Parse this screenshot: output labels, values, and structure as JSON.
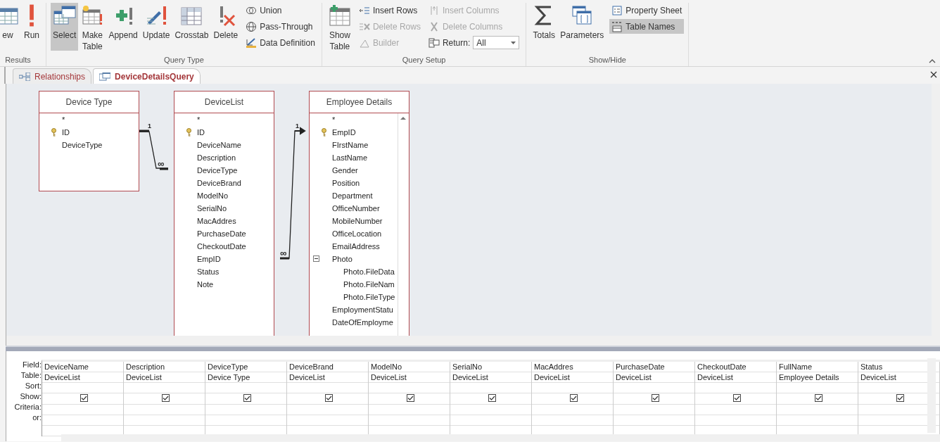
{
  "ribbon": {
    "groups": [
      {
        "label": "Results",
        "items": [
          {
            "kind": "large",
            "label": "ew",
            "selected": false
          },
          {
            "kind": "large",
            "label": "Run",
            "selected": false
          }
        ]
      },
      {
        "label": "Query Type",
        "items": [
          {
            "kind": "large",
            "label": "Select",
            "selected": true
          },
          {
            "kind": "large",
            "label": "Make Table",
            "selected": false
          },
          {
            "kind": "large",
            "label": "Append",
            "selected": false
          },
          {
            "kind": "large",
            "label": "Update",
            "selected": false
          },
          {
            "kind": "large",
            "label": "Crosstab",
            "selected": false
          },
          {
            "kind": "large",
            "label": "Delete",
            "selected": false
          },
          {
            "kind": "small",
            "label": "Union",
            "disabled": false,
            "on": false
          },
          {
            "kind": "small",
            "label": "Pass-Through",
            "disabled": false,
            "on": false
          },
          {
            "kind": "small",
            "label": "Data Definition",
            "disabled": false,
            "on": false
          }
        ]
      },
      {
        "label": "Query Setup",
        "items": [
          {
            "kind": "large",
            "label": "Show Table",
            "selected": false
          },
          {
            "kind": "small",
            "label": "Insert Rows",
            "disabled": false,
            "on": false
          },
          {
            "kind": "small",
            "label": "Delete Rows",
            "disabled": true,
            "on": false
          },
          {
            "kind": "small",
            "label": "Builder",
            "disabled": true,
            "on": false
          },
          {
            "kind": "small",
            "label": "Insert Columns",
            "disabled": true,
            "on": false
          },
          {
            "kind": "small",
            "label": "Delete Columns",
            "disabled": true,
            "on": false
          },
          {
            "kind": "dropdown",
            "label": "Return:",
            "value": "All"
          }
        ]
      },
      {
        "label": "Show/Hide",
        "items": [
          {
            "kind": "large",
            "label": "Totals",
            "selected": false
          },
          {
            "kind": "large",
            "label": "Parameters",
            "selected": false
          },
          {
            "kind": "small",
            "label": "Property Sheet",
            "disabled": false,
            "on": false
          },
          {
            "kind": "small",
            "label": "Table Names",
            "disabled": false,
            "on": true
          }
        ]
      }
    ]
  },
  "tabs": [
    {
      "label": "Relationships",
      "selected": false
    },
    {
      "label": "DeviceDetailsQuery",
      "selected": true
    }
  ],
  "design": {
    "tables": [
      {
        "name": "Device Type",
        "fields": [
          {
            "kind": "star",
            "label": "*"
          },
          {
            "kind": "key",
            "label": "ID"
          },
          {
            "kind": "field",
            "label": "DeviceType"
          }
        ]
      },
      {
        "name": "DeviceList",
        "fields": [
          {
            "kind": "star",
            "label": "*"
          },
          {
            "kind": "key",
            "label": "ID"
          },
          {
            "kind": "field",
            "label": "DeviceName"
          },
          {
            "kind": "field",
            "label": "Description"
          },
          {
            "kind": "field",
            "label": "DeviceType"
          },
          {
            "kind": "field",
            "label": "DeviceBrand"
          },
          {
            "kind": "field",
            "label": "ModelNo"
          },
          {
            "kind": "field",
            "label": "SerialNo"
          },
          {
            "kind": "field",
            "label": "MacAddres"
          },
          {
            "kind": "field",
            "label": "PurchaseDate"
          },
          {
            "kind": "field",
            "label": "CheckoutDate"
          },
          {
            "kind": "field",
            "label": "EmpID"
          },
          {
            "kind": "field",
            "label": "Status"
          },
          {
            "kind": "field",
            "label": "Note"
          }
        ]
      },
      {
        "name": "Employee Details",
        "fields": [
          {
            "kind": "star",
            "label": "*"
          },
          {
            "kind": "key",
            "label": "EmpID"
          },
          {
            "kind": "field",
            "label": "FIrstName"
          },
          {
            "kind": "field",
            "label": "LastName"
          },
          {
            "kind": "field",
            "label": "Gender"
          },
          {
            "kind": "field",
            "label": "Position"
          },
          {
            "kind": "field",
            "label": "Department"
          },
          {
            "kind": "field",
            "label": "OfficeNumber"
          },
          {
            "kind": "field",
            "label": "MobileNumber"
          },
          {
            "kind": "field",
            "label": "OfficeLocation"
          },
          {
            "kind": "field",
            "label": "EmailAddress"
          },
          {
            "kind": "group",
            "label": "Photo",
            "expanded": true,
            "children": [
              {
                "kind": "field",
                "label": "Photo.FileData"
              },
              {
                "kind": "field",
                "label": "Photo.FileNam"
              },
              {
                "kind": "field",
                "label": "Photo.FileType"
              }
            ]
          },
          {
            "kind": "field",
            "label": "EmploymentStatu"
          },
          {
            "kind": "field",
            "label": "DateOfEmployme"
          }
        ]
      }
    ],
    "relationships": [
      {
        "one": "1",
        "many": "∞"
      },
      {
        "one": "1",
        "many": "∞"
      }
    ]
  },
  "grid": {
    "row_labels": [
      "Field:",
      "Table:",
      "Sort:",
      "Show:",
      "Criteria:",
      "or:"
    ],
    "columns": [
      {
        "field": "DeviceName",
        "table": "DeviceList",
        "show": true
      },
      {
        "field": "Description",
        "table": "DeviceList",
        "show": true
      },
      {
        "field": "DeviceType",
        "table": "Device Type",
        "show": true
      },
      {
        "field": "DeviceBrand",
        "table": "DeviceList",
        "show": true
      },
      {
        "field": "ModelNo",
        "table": "DeviceList",
        "show": true
      },
      {
        "field": "SerialNo",
        "table": "DeviceList",
        "show": true
      },
      {
        "field": "MacAddres",
        "table": "DeviceList",
        "show": true
      },
      {
        "field": "PurchaseDate",
        "table": "DeviceList",
        "show": true
      },
      {
        "field": "CheckoutDate",
        "table": "DeviceList",
        "show": true
      },
      {
        "field": "FullName",
        "table": "Employee Details",
        "show": true
      },
      {
        "field": "Status",
        "table": "DeviceList",
        "show": true
      }
    ]
  }
}
